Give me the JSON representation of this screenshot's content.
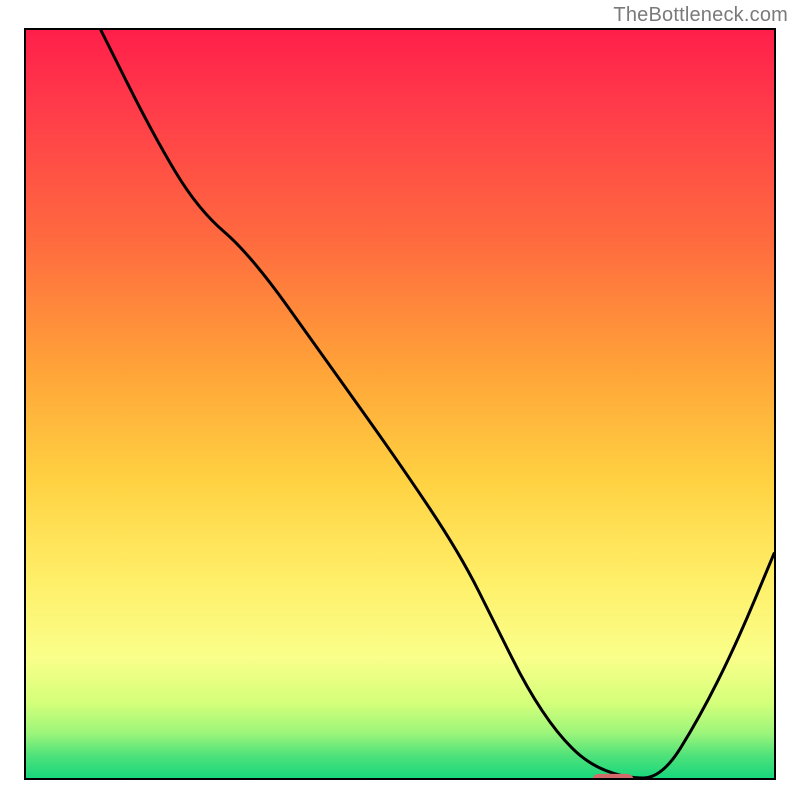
{
  "watermark": "TheBottleneck.com",
  "colors": {
    "gradient_top": "#ff1f4a",
    "gradient_mid1": "#ff6a3f",
    "gradient_mid2": "#ffd141",
    "gradient_mid3": "#f9ff8a",
    "gradient_bottom": "#18d77d",
    "curve": "#000000",
    "marker": "#d36a6a",
    "border": "#000000"
  },
  "chart_data": {
    "type": "line",
    "title": "",
    "xlabel": "",
    "ylabel": "",
    "xlim": [
      0,
      100
    ],
    "ylim": [
      0,
      100
    ],
    "grid": false,
    "annotations": [
      {
        "text": "TheBottleneck.com",
        "pos": "top-right"
      }
    ],
    "series": [
      {
        "name": "curve",
        "x": [
          10,
          17,
          23,
          30,
          40,
          50,
          58,
          63,
          67,
          71,
          75,
          80,
          85,
          90,
          95,
          100
        ],
        "y": [
          100,
          86,
          76,
          70,
          56,
          42,
          30,
          20,
          12,
          6,
          2,
          0,
          0,
          8,
          18,
          30
        ]
      }
    ],
    "marker": {
      "x": 78,
      "y": 0,
      "width_pct": 5.6,
      "height_pct": 1.9
    }
  }
}
